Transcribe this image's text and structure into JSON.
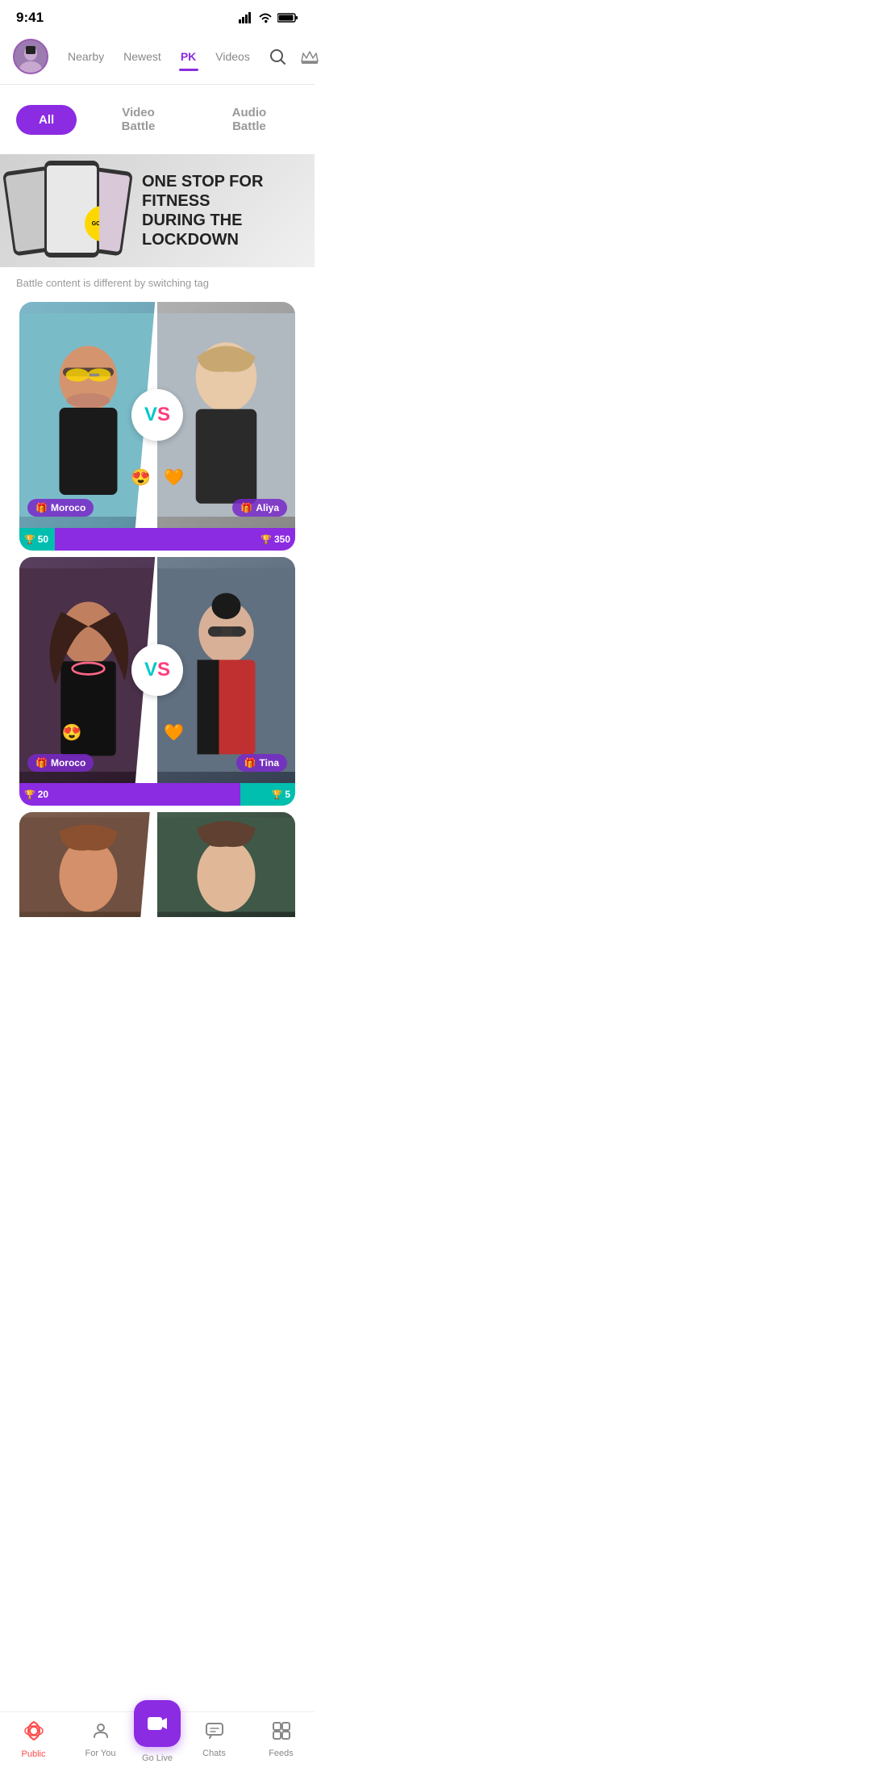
{
  "status": {
    "time": "9:41"
  },
  "header": {
    "nav_items": [
      {
        "id": "nearby",
        "label": "Nearby",
        "active": false
      },
      {
        "id": "newest",
        "label": "Newest",
        "active": false
      },
      {
        "id": "pk",
        "label": "PK",
        "active": true
      },
      {
        "id": "videos",
        "label": "Videos",
        "active": false
      }
    ]
  },
  "filter": {
    "tabs": [
      {
        "id": "all",
        "label": "All",
        "active": true
      },
      {
        "id": "video-battle",
        "label": "Video Battle",
        "active": false
      },
      {
        "id": "audio-battle",
        "label": "Audio Battle",
        "active": false
      }
    ]
  },
  "banner": {
    "gym_label": "GYM",
    "headline_line1": "ONE STOP FOR FITNESS",
    "headline_line2": "DURING THE LOCKDOWN"
  },
  "tag_hint": "Battle content is different by switching tag",
  "battles": [
    {
      "id": "battle-1",
      "left_name": "Moroco",
      "right_name": "Aliya",
      "left_emoji": "😍",
      "right_emoji": "🧡",
      "left_score": 50,
      "right_score": 350,
      "left_pct": 13
    },
    {
      "id": "battle-2",
      "left_name": "Moroco",
      "right_name": "Tina",
      "left_emoji": "😍",
      "right_emoji": "🧡",
      "left_score": 20,
      "right_score": 5,
      "left_pct": 80
    }
  ],
  "bottom_nav": {
    "tabs": [
      {
        "id": "public",
        "label": "Public",
        "active": true,
        "icon": "radio"
      },
      {
        "id": "for-you",
        "label": "For You",
        "active": false,
        "icon": "person"
      },
      {
        "id": "go-live",
        "label": "Go Live",
        "active": false,
        "icon": "camera"
      },
      {
        "id": "chats",
        "label": "Chats",
        "active": false,
        "icon": "chat"
      },
      {
        "id": "feeds",
        "label": "Feeds",
        "active": false,
        "icon": "grid"
      }
    ]
  },
  "vs_label": "VS"
}
